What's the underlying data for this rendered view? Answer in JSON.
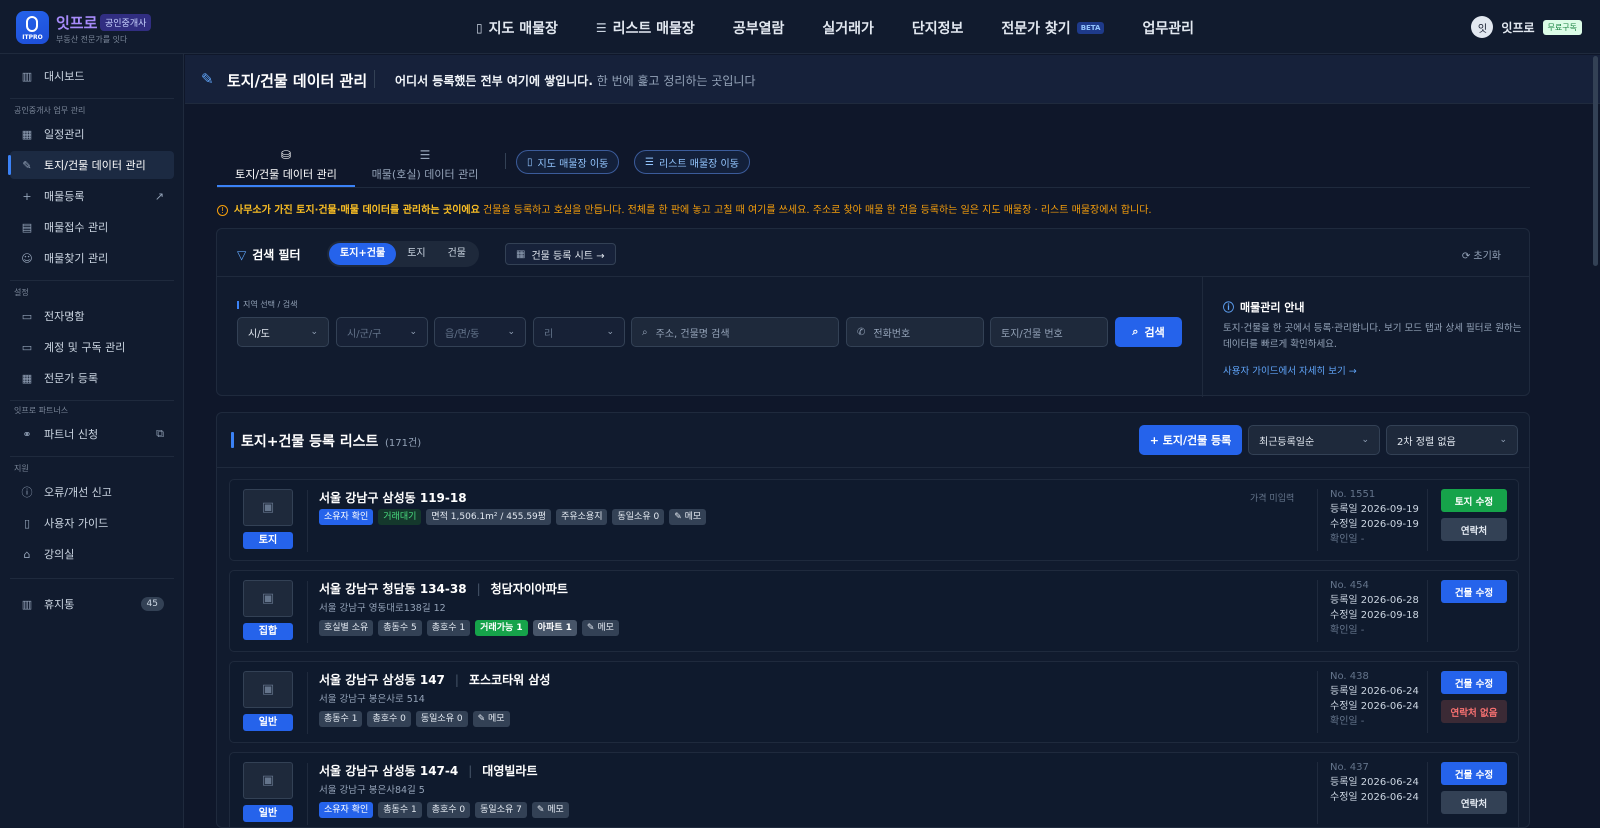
{
  "brand": {
    "logo_text": "ITPRO",
    "name": "잇프로",
    "badge": "공인중개사",
    "subtitle": "부동산 전문가를 잇다"
  },
  "nav": [
    {
      "icon": "map-icon",
      "glyph": "🗺",
      "label": "지도 매물장"
    },
    {
      "icon": "list-icon",
      "glyph": "☰",
      "label": "리스트 매물장"
    },
    {
      "label": "공부열람"
    },
    {
      "label": "실거래가"
    },
    {
      "label": "단지정보"
    },
    {
      "label": "전문가 찾기",
      "badge": "BETA"
    },
    {
      "label": "업무관리"
    }
  ],
  "user": {
    "avatar": "잇",
    "name": "잇프로",
    "plan": "무료구독"
  },
  "sidebar": {
    "dashboard": "대시보드",
    "section1": "공인중개사 업무 관리",
    "items1": [
      "일정관리",
      "토지/건물 데이터 관리",
      "매물등록",
      "매물접수 관리",
      "매물찾기 관리"
    ],
    "section2": "설정",
    "items2": [
      "전자명함",
      "계정 및 구독 관리",
      "전문가 등록"
    ],
    "section3": "잇프로 파트너스",
    "partner": "파트너 신청",
    "section4": "지원",
    "items4": [
      "오류/개선 신고",
      "사용자 가이드",
      "강의실"
    ],
    "trash": "휴지통",
    "trash_count": "45"
  },
  "page": {
    "title": "토지/건물 데이터 관리",
    "desc_bold": "어디서 등록했든 전부 여기에 쌓입니다.",
    "desc_rest": " 한 번에 훑고 정리하는 곳입니다"
  },
  "tabs": {
    "tab1": "토지/건물 데이터 관리",
    "tab2": "매물(호실) 데이터 관리",
    "map_btn": "지도 매물장 이동",
    "list_btn": "리스트 매물장 이동"
  },
  "notice": {
    "bold": "사무소가 가진 토지·건물·매물 데이터를 관리하는 곳이에요",
    "rest": " 건물을 등록하고 호실을 만듭니다. 전체를 한 판에 놓고 고칠 때 여기를 쓰세요. 주소로 찾아 매물 한 건을 등록하는 일은 지도 매물장 · 리스트 매물장에서 합니다."
  },
  "filter": {
    "title": "검색 필터",
    "seg": [
      "토지+건물",
      "토지",
      "건물"
    ],
    "sheet_btn": "건물 등록 시트 →",
    "reset": "초기화",
    "region_label": "지역 선택 / 검색",
    "sido": "시/도",
    "sigungu": "시/군/구",
    "eup": "읍/면/동",
    "ri": "리",
    "addr_ph": "주소, 건물명 검색",
    "phone_ph": "전화번호",
    "no_ph": "토지/건물 번호",
    "search": "검색"
  },
  "guide": {
    "title": "매물관리 안내",
    "desc": "토지·건물을 한 곳에서 등록·관리합니다. 보기 모드 탭과 상세 필터로 원하는 데이터를 빠르게 확인하세요.",
    "link": "사용자 가이드에서 자세히 보기 →"
  },
  "list": {
    "title": "토지+건물 등록 리스트",
    "count": "(171건)",
    "add_btn": "+ 토지/건물 등록",
    "sort1": "최근등록일순",
    "sort2": "2차 정렬 없음"
  },
  "rows": [
    {
      "type": "토지",
      "addr": "서울 강남구 삼성동 119-18",
      "name": "",
      "sub": "",
      "price": "가격 미입력",
      "tags": [
        {
          "t": "소유자 확인",
          "c": "blue"
        },
        {
          "t": "거래대기",
          "c": "green-o"
        },
        {
          "t": "면적 1,506.1m² / 455.59평",
          "c": ""
        },
        {
          "t": "주유소용지",
          "c": ""
        },
        {
          "t": "동일소유 0",
          "c": ""
        },
        {
          "t": "✎ 메모",
          "c": ""
        }
      ],
      "no": "No. 1551",
      "reg": "등록일 2026-09-19",
      "mod": "수정일 2026-09-19",
      "chk": "확인일 -",
      "btn1": "토지 수정",
      "btn1c": "green",
      "btn2": "연락처",
      "btn2c": "gray"
    },
    {
      "type": "집합",
      "addr": "서울 강남구 청담동 134-38",
      "name": "청담자이아파트",
      "sub": "서울 강남구 영동대로138길 12",
      "price": "",
      "tags": [
        {
          "t": "호실별 소유",
          "c": ""
        },
        {
          "t": "총동수 5",
          "c": ""
        },
        {
          "t": "총호수 1",
          "c": ""
        },
        {
          "t": "거래가능 1",
          "c": "green"
        },
        {
          "t": "아파트 1",
          "c": "gray-b"
        },
        {
          "t": "✎ 메모",
          "c": ""
        }
      ],
      "no": "No. 454",
      "reg": "등록일 2026-06-28",
      "mod": "수정일 2026-09-18",
      "chk": "확인일 -",
      "btn1": "건물 수정",
      "btn1c": "blue",
      "btn2": "",
      "btn2c": ""
    },
    {
      "type": "일반",
      "addr": "서울 강남구 삼성동 147",
      "name": "포스코타워 삼성",
      "sub": "서울 강남구 봉은사로 514",
      "price": "",
      "tags": [
        {
          "t": "총동수 1",
          "c": ""
        },
        {
          "t": "총호수 0",
          "c": ""
        },
        {
          "t": "동일소유 0",
          "c": ""
        },
        {
          "t": "✎ 메모",
          "c": ""
        }
      ],
      "no": "No. 438",
      "reg": "등록일 2026-06-24",
      "mod": "수정일 2026-06-24",
      "chk": "확인일 -",
      "btn1": "건물 수정",
      "btn1c": "blue",
      "btn2": "연락처 없음",
      "btn2c": "red"
    },
    {
      "type": "일반",
      "addr": "서울 강남구 삼성동 147-4",
      "name": "대영빌라트",
      "sub": "서울 강남구 봉은사84길 5",
      "price": "",
      "tags": [
        {
          "t": "소유자 확인",
          "c": "blue"
        },
        {
          "t": "총동수 1",
          "c": ""
        },
        {
          "t": "총호수 0",
          "c": ""
        },
        {
          "t": "동일소유 7",
          "c": ""
        },
        {
          "t": "✎ 메모",
          "c": ""
        }
      ],
      "no": "No. 437",
      "reg": "등록일 2026-06-24",
      "mod": "수정일 2026-06-24",
      "chk": "",
      "btn1": "건물 수정",
      "btn1c": "blue",
      "btn2": "연락처",
      "btn2c": "gray"
    }
  ]
}
